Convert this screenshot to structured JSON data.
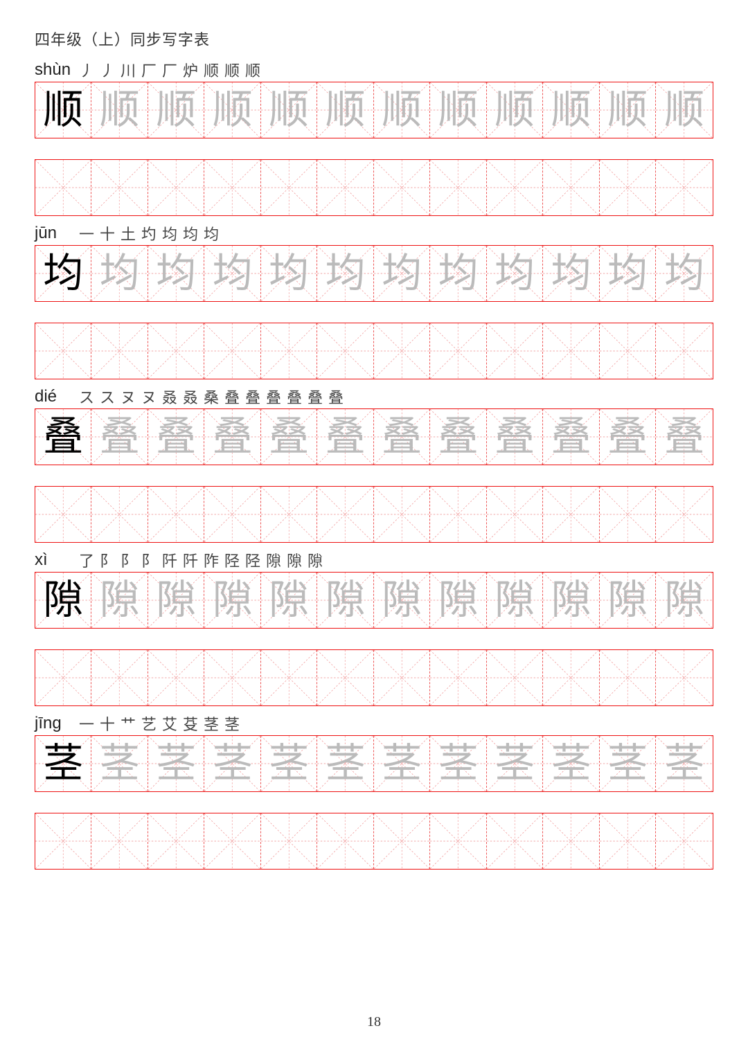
{
  "title": "四年级（上）同步写字表",
  "page_number": "18",
  "grid": {
    "columns_per_row": 12,
    "trace_copies": 11
  },
  "characters": [
    {
      "pinyin": "shùn",
      "hanzi": "顺",
      "strokes": [
        "丿",
        "丿",
        "川",
        "厂",
        "厂",
        "炉",
        "顺",
        "顺",
        "顺"
      ]
    },
    {
      "pinyin": "jūn",
      "hanzi": "均",
      "strokes": [
        "一",
        "十",
        "土",
        "圴",
        "均",
        "均",
        "均"
      ]
    },
    {
      "pinyin": "dié",
      "hanzi": "叠",
      "strokes": [
        "ス",
        "ス",
        "ヌ",
        "ヌ",
        "叒",
        "叒",
        "桑",
        "叠",
        "叠",
        "叠",
        "叠",
        "叠",
        "叠"
      ]
    },
    {
      "pinyin": "xì",
      "hanzi": "隙",
      "strokes": [
        "了",
        "阝",
        "阝",
        "阝",
        "阡",
        "阡",
        "阼",
        "陉",
        "陉",
        "隙",
        "隙",
        "隙"
      ]
    },
    {
      "pinyin": "jīng",
      "hanzi": "茎",
      "strokes": [
        "一",
        "十",
        "艹",
        "艺",
        "艾",
        "芟",
        "茎",
        "茎"
      ]
    }
  ]
}
